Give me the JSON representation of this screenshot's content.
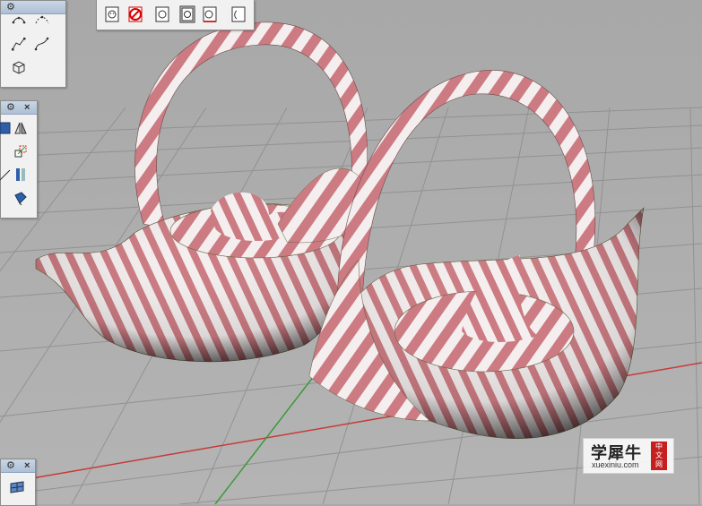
{
  "viewport": {
    "grid_color": "#8d8d8d",
    "axis_red": "#c73a3a",
    "axis_green": "#3a9a3a",
    "stripe_pink": "#cf7e84",
    "stripe_white": "#f5f0f0"
  },
  "toolbars": {
    "top": {
      "icons": [
        "face-view-icon",
        "face-view-no-icon",
        "face-front-icon",
        "face-front-boxed-icon",
        "face-side-icon",
        "face-shadow-icon"
      ]
    },
    "left_top": {
      "icons": [
        "curve-dots-icon",
        "arc-dots-icon",
        "polyline-icon",
        "curve-edit-icon",
        "box-icon"
      ]
    },
    "left_mid": {
      "icons": [
        "cube-icon",
        "mirror-icon",
        "scale-icon",
        "split-icon",
        "diagonal-icon",
        "extrude-icon"
      ]
    },
    "left_bottom": {
      "icons": [
        "plane-grid-icon"
      ]
    }
  },
  "watermark": {
    "title": "学犀牛",
    "url": "xuexiniu.com",
    "badge": [
      "中",
      "文",
      "网"
    ]
  }
}
